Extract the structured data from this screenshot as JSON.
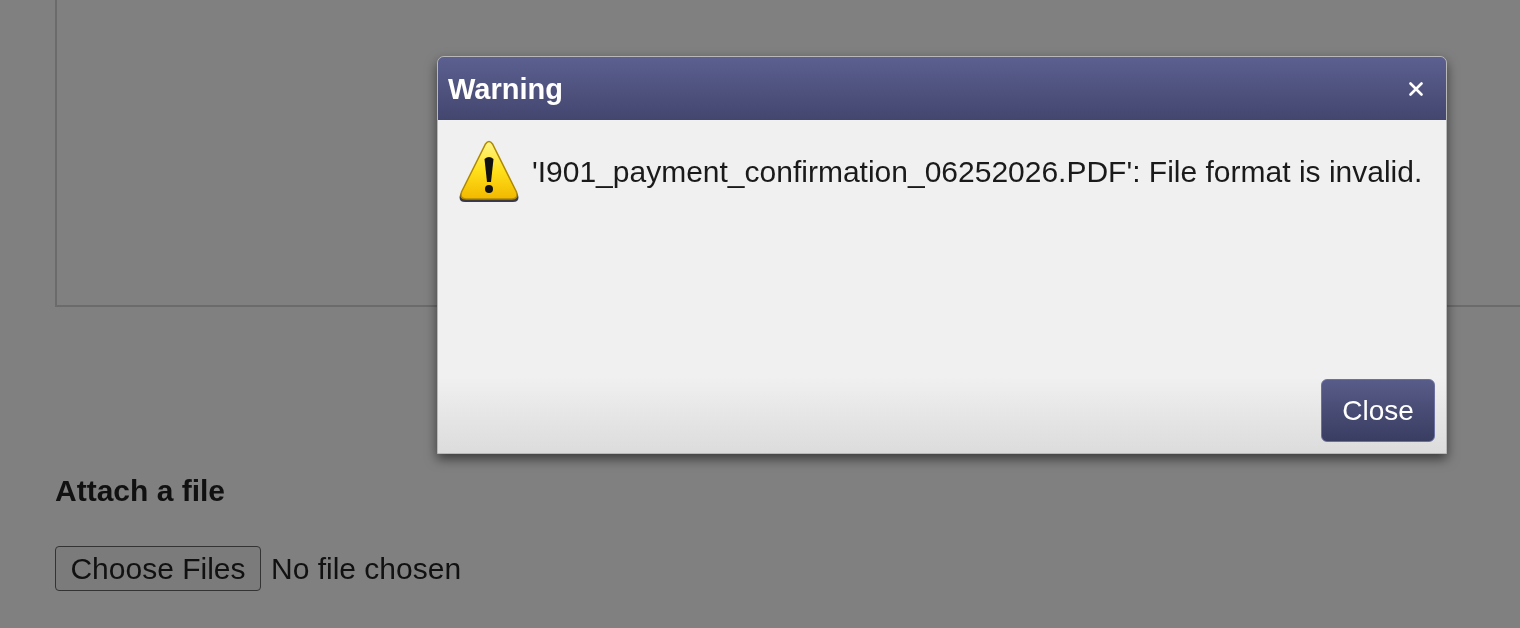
{
  "page": {
    "section_title": "Attach a file",
    "file_input": {
      "button": "Choose Files",
      "status": "No file chosen"
    }
  },
  "dialog": {
    "title": "Warning",
    "message": "'I901_payment_confirmation_06252026.PDF': File format is invalid.",
    "buttons": [
      "Close"
    ]
  }
}
